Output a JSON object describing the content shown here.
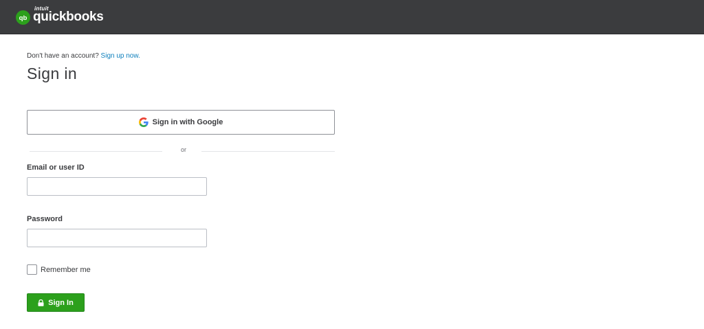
{
  "header": {
    "logo_small": "intuit",
    "logo_text": "quickbooks",
    "logo_mark": "qb",
    "brand_color": "#2ca01c",
    "background_color": "#3b3c3e"
  },
  "signup": {
    "prompt": "Don't have an account?",
    "link": "Sign up now."
  },
  "title": "Sign in",
  "google_button": {
    "label": "Sign in with Google",
    "icon": "google-g-icon"
  },
  "divider": {
    "text": "or"
  },
  "email": {
    "label": "Email or user ID",
    "value": "",
    "placeholder": ""
  },
  "password": {
    "label": "Password",
    "value": "",
    "placeholder": ""
  },
  "remember": {
    "label": "Remember me",
    "checked": false
  },
  "signin_button": {
    "label": "Sign In",
    "icon": "lock-icon",
    "color": "#2ca01c"
  },
  "colors": {
    "link": "#0d7fbc",
    "text": "#393a3d"
  }
}
